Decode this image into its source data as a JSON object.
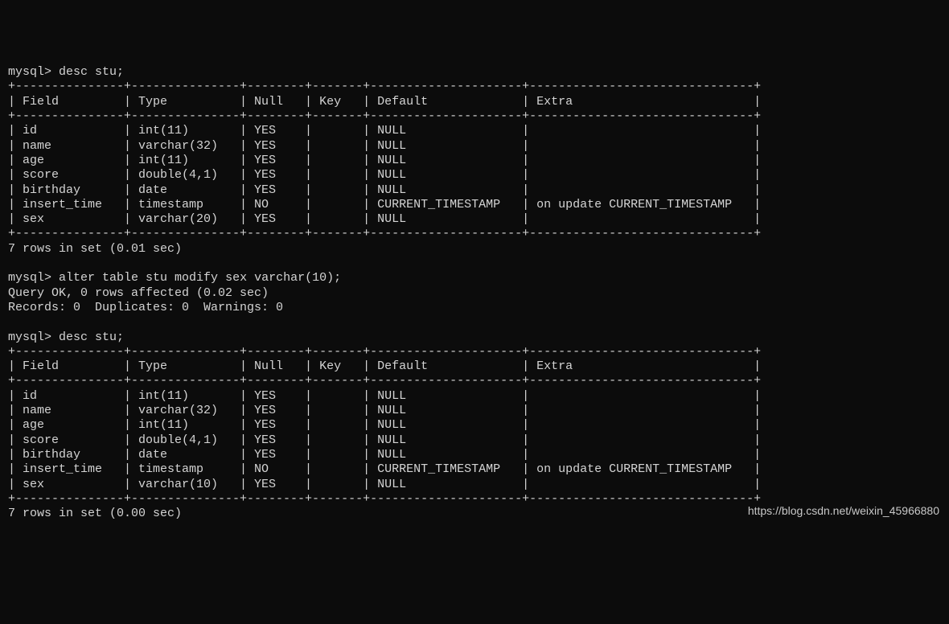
{
  "session": {
    "prompt": "mysql>",
    "cmd1": "desc stu;",
    "cmd2": "alter table stu modify sex varchar(10);",
    "cmd3": "desc stu;",
    "query_ok": "Query OK, 0 rows affected (0.02 sec)",
    "records_line": "Records: 0  Duplicates: 0  Warnings: 0",
    "result1_summary": "7 rows in set (0.01 sec)",
    "result2_summary": "7 rows in set (0.00 sec)"
  },
  "table_headers": [
    "Field",
    "Type",
    "Null",
    "Key",
    "Default",
    "Extra"
  ],
  "table1_rows": [
    {
      "field": "id",
      "type": "int(11)",
      "null": "YES",
      "key": "",
      "default": "NULL",
      "extra": ""
    },
    {
      "field": "name",
      "type": "varchar(32)",
      "null": "YES",
      "key": "",
      "default": "NULL",
      "extra": ""
    },
    {
      "field": "age",
      "type": "int(11)",
      "null": "YES",
      "key": "",
      "default": "NULL",
      "extra": ""
    },
    {
      "field": "score",
      "type": "double(4,1)",
      "null": "YES",
      "key": "",
      "default": "NULL",
      "extra": ""
    },
    {
      "field": "birthday",
      "type": "date",
      "null": "YES",
      "key": "",
      "default": "NULL",
      "extra": ""
    },
    {
      "field": "insert_time",
      "type": "timestamp",
      "null": "NO",
      "key": "",
      "default": "CURRENT_TIMESTAMP",
      "extra": "on update CURRENT_TIMESTAMP"
    },
    {
      "field": "sex",
      "type": "varchar(20)",
      "null": "YES",
      "key": "",
      "default": "NULL",
      "extra": ""
    }
  ],
  "table2_rows": [
    {
      "field": "id",
      "type": "int(11)",
      "null": "YES",
      "key": "",
      "default": "NULL",
      "extra": ""
    },
    {
      "field": "name",
      "type": "varchar(32)",
      "null": "YES",
      "key": "",
      "default": "NULL",
      "extra": ""
    },
    {
      "field": "age",
      "type": "int(11)",
      "null": "YES",
      "key": "",
      "default": "NULL",
      "extra": ""
    },
    {
      "field": "score",
      "type": "double(4,1)",
      "null": "YES",
      "key": "",
      "default": "NULL",
      "extra": ""
    },
    {
      "field": "birthday",
      "type": "date",
      "null": "YES",
      "key": "",
      "default": "NULL",
      "extra": ""
    },
    {
      "field": "insert_time",
      "type": "timestamp",
      "null": "NO",
      "key": "",
      "default": "CURRENT_TIMESTAMP",
      "extra": "on update CURRENT_TIMESTAMP"
    },
    {
      "field": "sex",
      "type": "varchar(10)",
      "null": "YES",
      "key": "",
      "default": "NULL",
      "extra": ""
    }
  ],
  "watermark": "https://blog.csdn.net/weixin_45966880"
}
